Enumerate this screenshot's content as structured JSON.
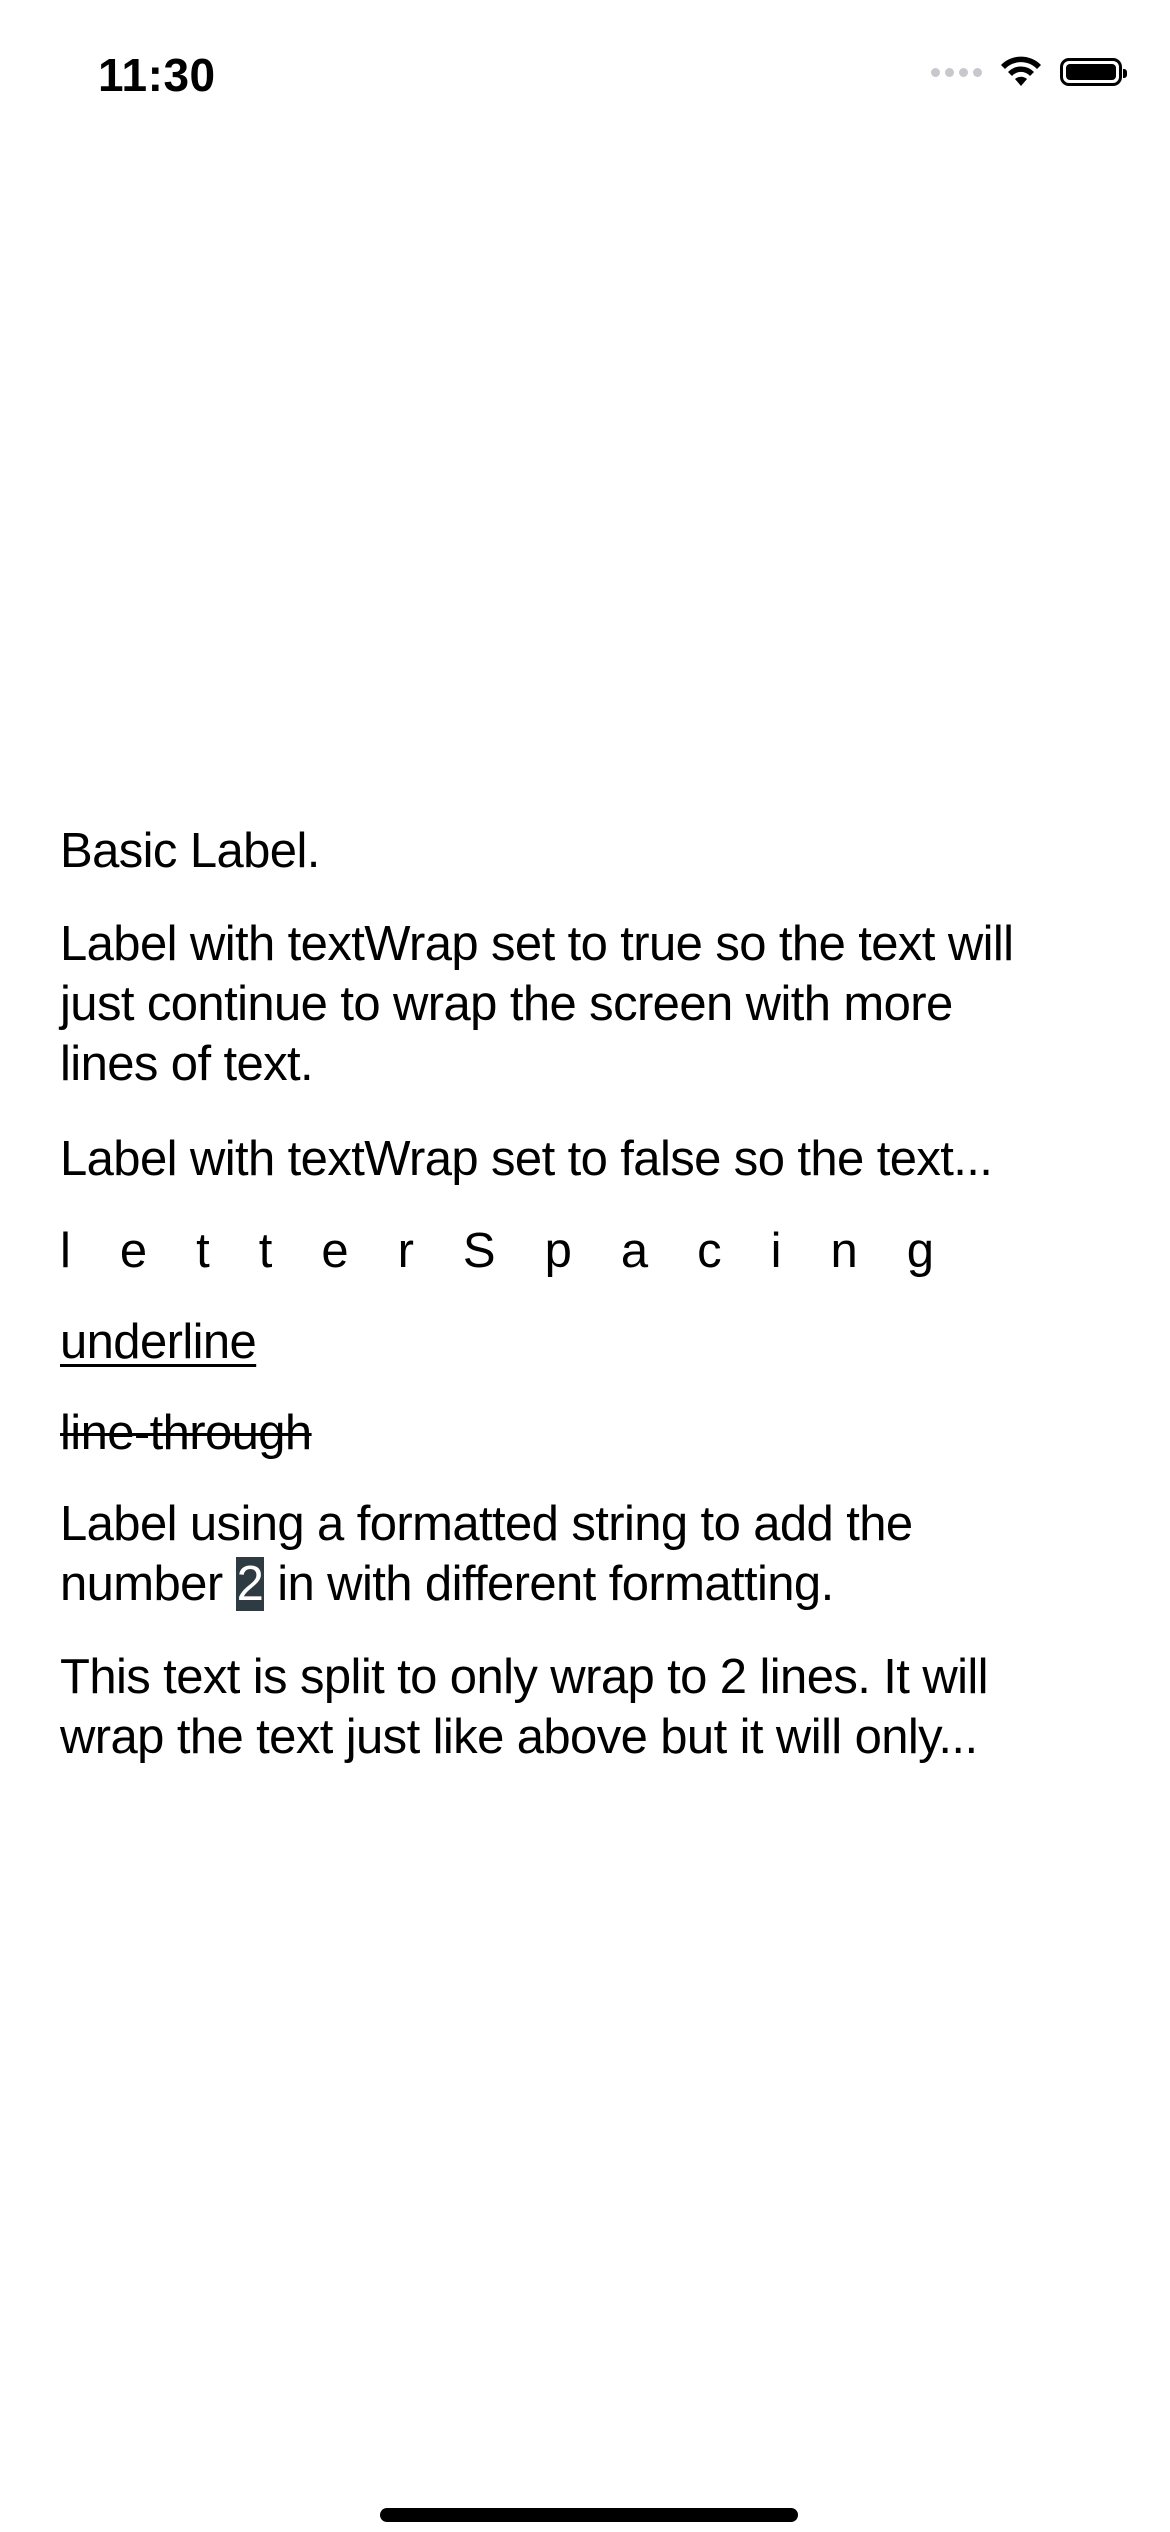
{
  "status_bar": {
    "time": "11:30",
    "icons": [
      "signal-dots-icon",
      "wifi-icon",
      "battery-icon"
    ]
  },
  "labels": {
    "basic": "Basic Label.",
    "wrap_true_lines": [
      "Label with textWrap set to true so the text will",
      "just continue to wrap the screen with more",
      "lines of text."
    ],
    "wrap_false": "Label with textWrap set to false so the text...",
    "letter_spacing": "letterSpacing",
    "underline": "underline",
    "line_through": "line-through",
    "formatted": {
      "line1": "Label using a formatted string to add the",
      "prefix": "number ",
      "number": "2",
      "suffix": " in with different formatting."
    },
    "max_lines": [
      "This text is split to only wrap to 2 lines. It will",
      "wrap the text just like above but it will only..."
    ]
  },
  "colors": {
    "highlight_bg": "#2f3b43",
    "highlight_fg": "#ffffff"
  }
}
